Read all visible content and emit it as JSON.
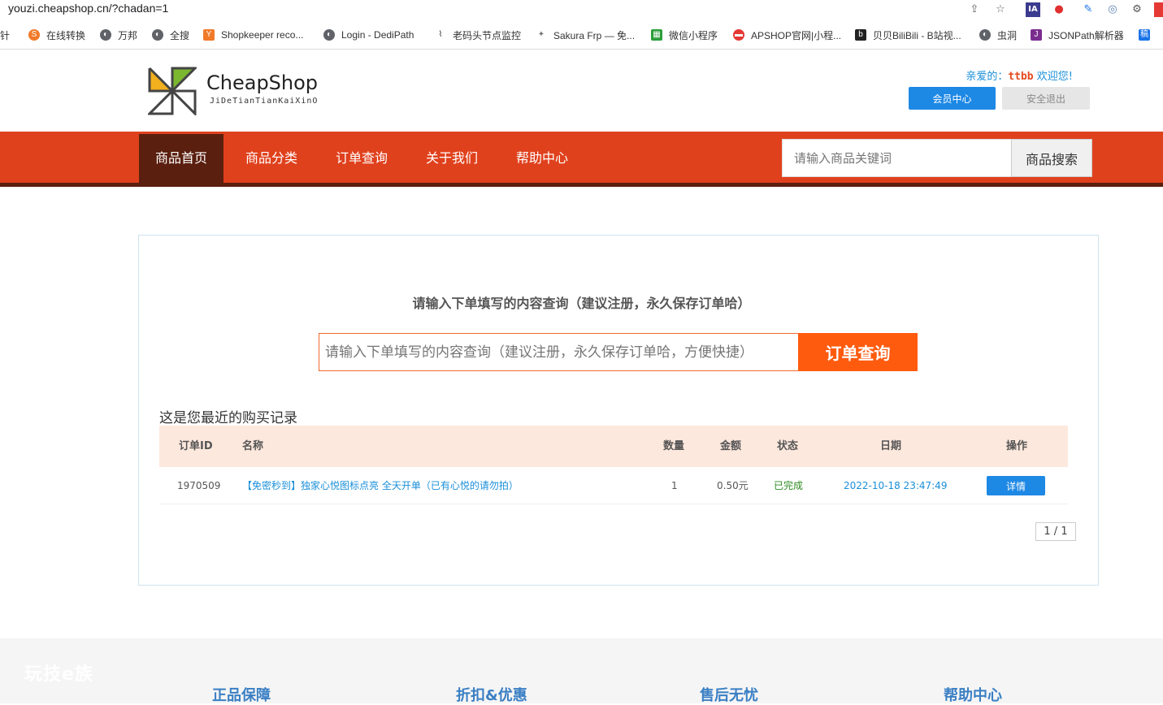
{
  "browser": {
    "url": "youzi.cheapshop.cn/?chadan=1",
    "bookmarks": [
      {
        "label": "针"
      },
      {
        "label": "在线转换"
      },
      {
        "label": "万邦"
      },
      {
        "label": "全搜"
      },
      {
        "label": "Shopkeeper reco..."
      },
      {
        "label": "Login - DediPath"
      },
      {
        "label": "老码头节点监控"
      },
      {
        "label": "Sakura Frp — 免..."
      },
      {
        "label": "微信小程序"
      },
      {
        "label": "APSHOP官网|小程..."
      },
      {
        "label": "贝贝BiliBili - B站视..."
      },
      {
        "label": "虫洞"
      },
      {
        "label": "JSONPath解析器"
      }
    ]
  },
  "header": {
    "logo_title": "CheapShop",
    "logo_sub": "JiDeTianTianKaiXinO",
    "greeting_prefix": "亲爱的：",
    "username": "ttbb",
    "greeting_suffix": "欢迎您!",
    "member_button": "会员中心",
    "logout_button": "安全退出"
  },
  "nav": {
    "items": [
      "商品首页",
      "商品分类",
      "订单查询",
      "关于我们",
      "帮助中心"
    ],
    "search_placeholder": "请输入商品关键词",
    "search_button": "商品搜索"
  },
  "query": {
    "hint": "请输入下单填写的内容查询（建议注册，永久保存订单哈）",
    "placeholder": "请输入下单填写的内容查询（建议注册，永久保存订单哈，方便快捷）",
    "button": "订单查询"
  },
  "records": {
    "title": "这是您最近的购买记录",
    "columns": [
      "订单ID",
      "名称",
      "数量",
      "金额",
      "状态",
      "日期",
      "操作"
    ],
    "rows": [
      {
        "id": "1970509",
        "name": "【免密秒到】独家心悦图标点亮 全天开单（已有心悦的请勿拍）",
        "qty": "1",
        "amount": "0.50元",
        "status": "已完成",
        "date": "2022-10-18 23:47:49",
        "action": "详情"
      }
    ],
    "pager": "1 / 1"
  },
  "footer": {
    "watermark": "玩技e族",
    "columns": [
      "正品保障",
      "折扣&优惠",
      "售后无忧",
      "帮助中心"
    ]
  },
  "colors": {
    "nav": "#e0411d",
    "nav_active": "#5a1f0f",
    "query_button": "#ff5b0f",
    "primary_button": "#1e88e5",
    "table_header": "#fde8dd"
  }
}
